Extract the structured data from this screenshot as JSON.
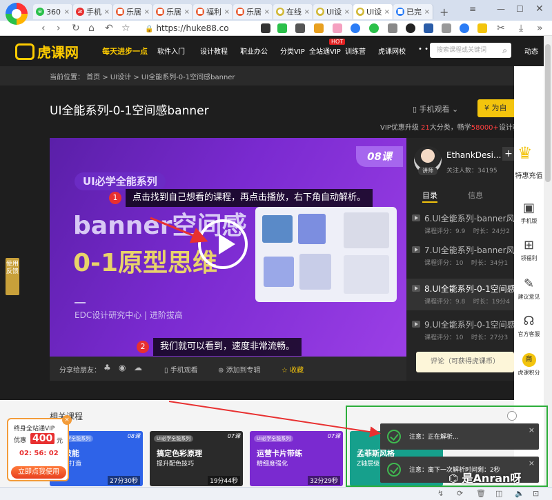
{
  "browser": {
    "tabs": [
      {
        "label": "360",
        "color": "#2bc04a",
        "glyph": "e"
      },
      {
        "label": "手机",
        "color": "#e83030",
        "glyph": "≥"
      },
      {
        "label": "乐居",
        "color": "#e85a30",
        "glyph": "■"
      },
      {
        "label": "乐居",
        "color": "#e85a30",
        "glyph": "■"
      },
      {
        "label": "福利",
        "color": "#e85a30",
        "glyph": "■"
      },
      {
        "label": "乐居",
        "color": "#e85a30",
        "glyph": "■"
      },
      {
        "label": "在线",
        "color": "#d2b93a",
        "glyph": "●"
      },
      {
        "label": "UI设",
        "color": "#d2b93a",
        "glyph": "●"
      },
      {
        "label": "UI设",
        "color": "#d2b93a",
        "glyph": "●"
      },
      {
        "label": "已完",
        "color": "#2a7cf6",
        "glyph": "■"
      }
    ],
    "new_tab": "+",
    "url": "https://huke88.co",
    "window_controls": {
      "menu": "≡",
      "minimize": "—",
      "maximize": "☐",
      "close": "✕"
    }
  },
  "site": {
    "logo_text": "虎课网",
    "slogan": "每天进步一点",
    "nav": [
      "软件入门",
      "设计教程",
      "职业办公",
      "分类VIP",
      "全站通VIP",
      "训练营",
      "虎课网校"
    ],
    "nav_hot_badge": "HOT",
    "more": "• • •",
    "search_placeholder": "搜索课程或关键词",
    "dongtai": "动态"
  },
  "breadcrumb": "当前位置： 首页 > UI设计 > UI全能系列-0-1空间感banner",
  "course": {
    "title": "UI全能系列-0-1空间感banner",
    "mobile_watch": "手机观看",
    "self_buy": "¥ 为自",
    "vip_prefix": "VIP优惠升级 ",
    "vip_num": "21",
    "vip_mid": "大分类，畅学",
    "vip_num2": "58000+",
    "vip_suffix": "设计教"
  },
  "video": {
    "lesson_badge": "08课",
    "series": "UI必学全能系列",
    "headline1": "banner空间感",
    "headline2": "0-1原型思维",
    "studio": "EDC设计研究中心 | 进阶拔高",
    "annotation1_num": "1",
    "annotation1": "点击找到自己想看的课程，再点击播放，右下角自动解析。",
    "annotation2_num": "2",
    "annotation2": "我们就可以看到，速度非常流畅。"
  },
  "sharebar": {
    "share": "分享给朋友：",
    "mobile": "手机观看",
    "add_album": "添加到专辑",
    "collect": "收藏"
  },
  "sidebar": {
    "teacher_name": "EthankDesi...",
    "teacher_tag": "讲师",
    "followers": "关注人数：34195",
    "add": "+",
    "tab_catalog": "目录",
    "tab_info": "信息",
    "lessons": [
      {
        "title": "6.UI全能系列-banner风格",
        "rating": "课程评分：9.9",
        "time": "时长：24分2",
        "active": false
      },
      {
        "title": "7.UI全能系列-banner风格",
        "rating": "课程评分：10",
        "time": "时长：34分1",
        "active": false
      },
      {
        "title": "8.UI全能系列-0-1空间感b",
        "rating": "课程评分：9.8",
        "time": "时长：19分4",
        "active": true
      },
      {
        "title": "9.UI全能系列-0-1空间感b",
        "rating": "课程评分：10",
        "time": "时长：27分3",
        "active": false
      }
    ],
    "comment_button": "评论（可获得虎课币）"
  },
  "rail": {
    "special": "特惠充值",
    "mobile": "手机版",
    "welfare": "领福利",
    "suggest": "建议意见",
    "service": "官方客服",
    "points": "虎课积分",
    "points_icon": "商"
  },
  "feedback": "使用反馈",
  "related": {
    "title": "相关课程",
    "cards": [
      {
        "pill": "UI必学全能系列",
        "title": "新技能",
        "sub": "场景打造",
        "duration": "27分30秒",
        "num": "08课",
        "bg": "#2e63e8"
      },
      {
        "pill": "UI必学全能系列",
        "title": "搞定色彩原理",
        "sub": "提升配色技巧",
        "duration": "19分44秒",
        "num": "07课",
        "bg": "#2a2a2a"
      },
      {
        "pill": "UI必学全能系列",
        "title": "运营卡片带练",
        "sub": "精细度强化",
        "duration": "32分29秒",
        "num": "07课",
        "bg": "#7a2ad0"
      },
      {
        "pill": "",
        "title": "孟菲斯风格",
        "sub": "Z轴层级",
        "duration": "",
        "num": "",
        "bg": "#16a08c"
      }
    ]
  },
  "vip_popup": {
    "line1": "终身全站通VIP",
    "line2": "优惠",
    "price": "400",
    "unit": "元",
    "timer": "02: 56: 02",
    "button": "立即点我使用",
    "close": "×"
  },
  "notifications": [
    {
      "text": "注意：正在解析...",
      "close": "×"
    },
    {
      "text": "注意：离下一次解析时间剩：2秒",
      "close": "×"
    }
  ],
  "watermark": "是Anran呀",
  "colors": {
    "accent": "#f3c40d",
    "video_purple": "#7a2ad0",
    "success": "#3fb950",
    "alert_red": "#e83030",
    "highlight_green": "#2cae3a"
  }
}
